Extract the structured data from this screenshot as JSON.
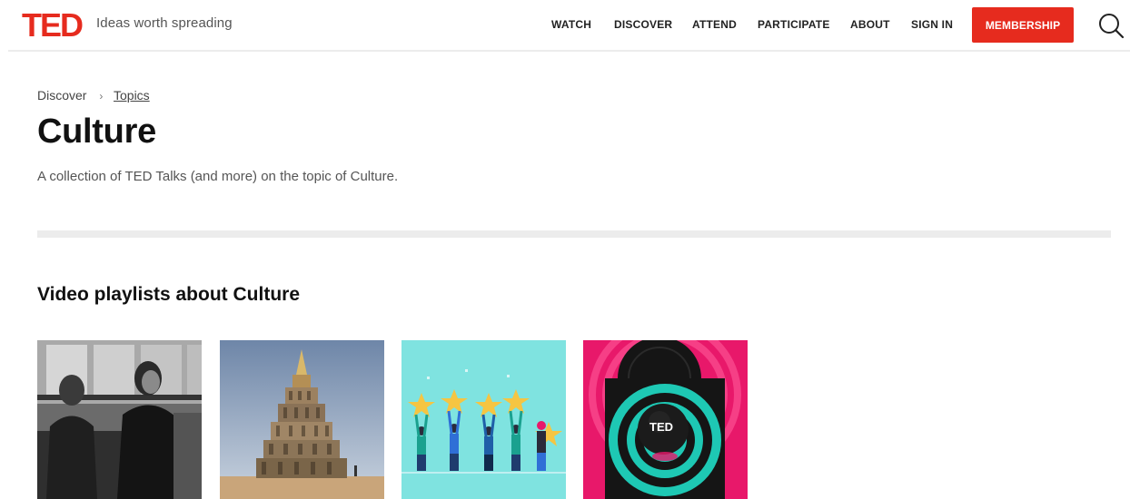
{
  "header": {
    "logo_text": "TED",
    "tagline": "Ideas worth spreading",
    "nav": {
      "watch": "WATCH",
      "discover": "DISCOVER",
      "attend": "ATTEND",
      "participate": "PARTICIPATE",
      "about": "ABOUT",
      "sign_in": "SIGN IN"
    },
    "membership_label": "MEMBERSHIP"
  },
  "breadcrumb": {
    "parent": "Discover",
    "current": "Topics"
  },
  "page": {
    "title": "Culture",
    "description": "A collection of TED Talks (and more) on the topic of Culture."
  },
  "playlists": {
    "heading": "Video playlists about Culture",
    "cards": [
      {
        "icon": "civil-rights-bus-photo"
      },
      {
        "icon": "tower-sculpture-photo"
      },
      {
        "icon": "people-holding-stars-illustration"
      },
      {
        "icon": "ted-spiral-record-illustration",
        "badge": "TED"
      }
    ]
  },
  "colors": {
    "brand_red": "#e62b1e",
    "divider_gray": "#ececec",
    "card3_bg": "#7fe3e0",
    "card4_bg": "#e8186a"
  }
}
